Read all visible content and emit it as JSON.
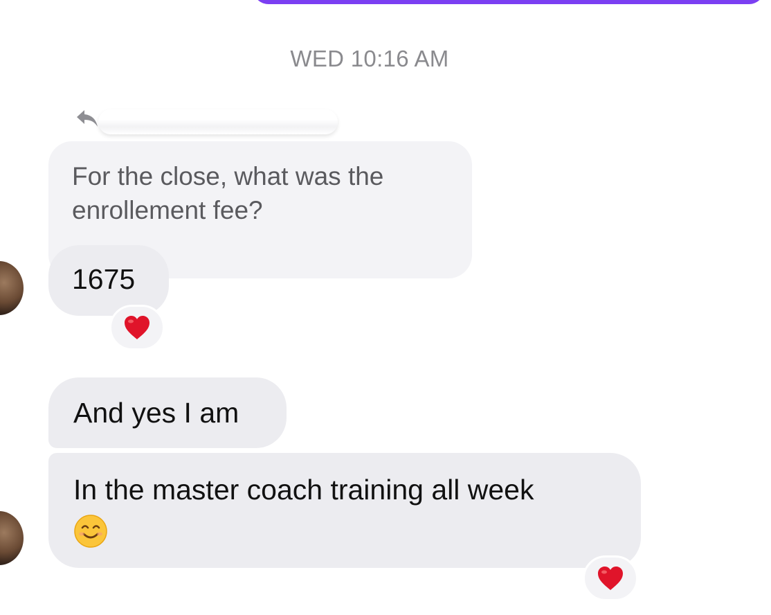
{
  "thread": {
    "timestamp": "WED 10:16 AM",
    "quoted_message": {
      "text": "For the close, what was the enrollement fee?"
    },
    "messages": [
      {
        "id": "msg-1675",
        "text": "1675",
        "reaction": "heart-icon"
      },
      {
        "id": "msg-yes",
        "text": "And yes I am"
      },
      {
        "id": "msg-master",
        "text": "In the master coach training all week",
        "emoji": "smiling-face-icon",
        "reaction": "heart-icon"
      }
    ]
  },
  "colors": {
    "accent": "#7b3ff2",
    "bubble": "#ececf0",
    "timestamp": "#8a8a8e",
    "heart": "#e0142a"
  }
}
